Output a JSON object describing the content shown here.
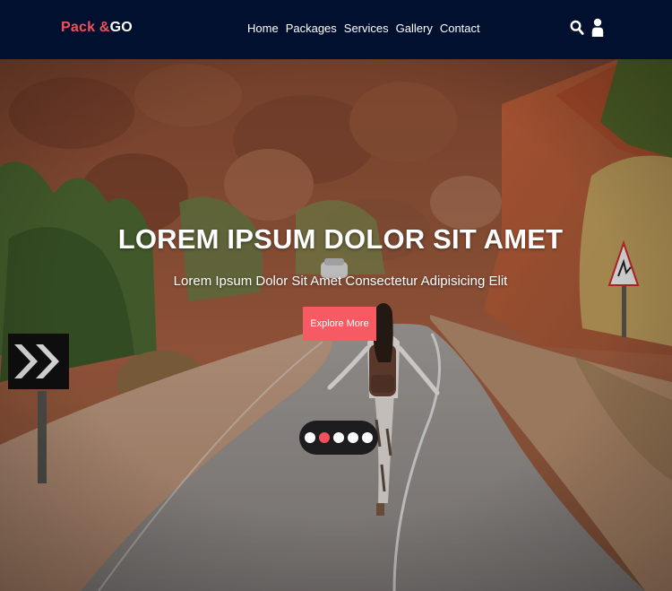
{
  "brand": {
    "part1": "Pack &",
    "part2": "GO",
    "accent_color": "#f0525c",
    "nav_bg": "#01102f"
  },
  "nav": {
    "links": [
      "Home",
      "Packages",
      "Services",
      "Gallery",
      "Contact"
    ],
    "icons": [
      "search-icon",
      "user-icon"
    ]
  },
  "hero": {
    "title": "LOREM IPSUM DOLOR SIT AMET",
    "subtitle": "Lorem Ipsum Dolor Sit Amet Consectetur Adipisicing Elit",
    "cta_label": "Explore More",
    "cta_color": "#f65b63"
  },
  "slider": {
    "count": 5,
    "active_index": 1
  }
}
